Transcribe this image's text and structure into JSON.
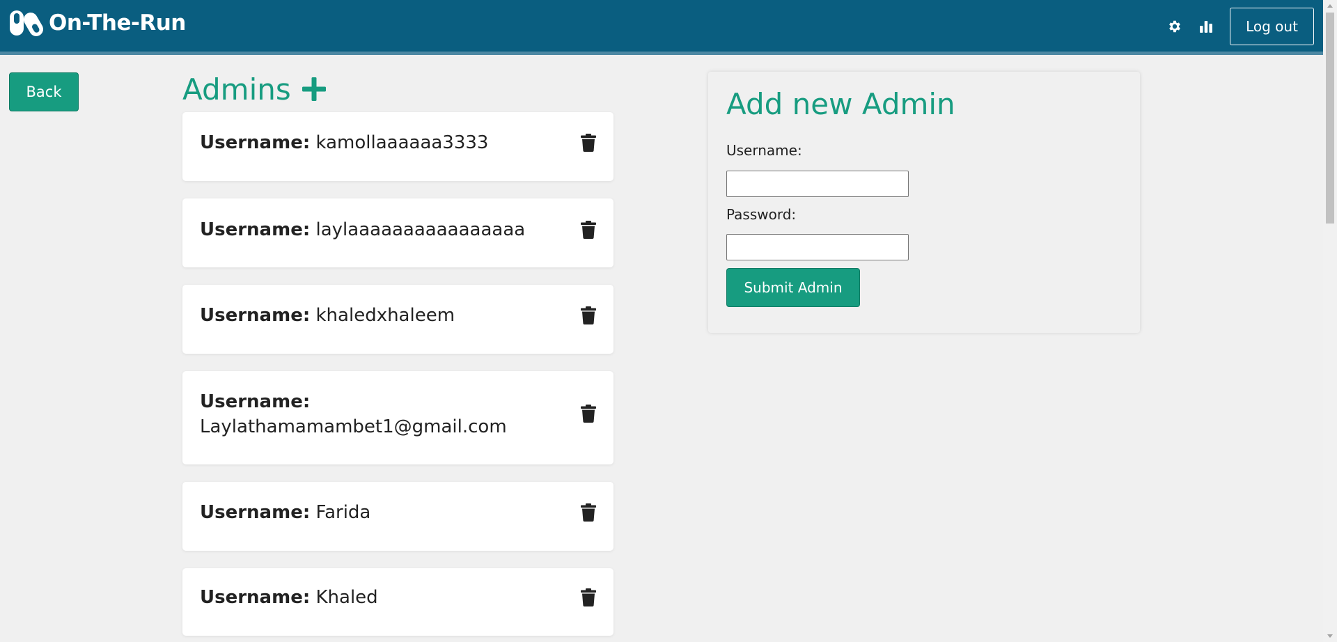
{
  "navbar": {
    "brand_name": "On-The-Run",
    "brand_icon": "pills-logo-icon",
    "settings_icon": "gear-icon",
    "stats_icon": "bar-chart-icon",
    "logout_label": "Log out",
    "bg_color": "#0a5e80"
  },
  "back_label": "Back",
  "admins": {
    "title": "Admins",
    "add_icon": "plus-icon",
    "field_label": "Username:",
    "items": [
      {
        "username": "kamollaaaaaa3333"
      },
      {
        "username": "laylaaaaaaaaaaaaaaaa"
      },
      {
        "username": "khaledxhaleem"
      },
      {
        "username": "Laylathamamambet1@gmail.com"
      },
      {
        "username": "Farida"
      },
      {
        "username": "Khaled"
      }
    ]
  },
  "form": {
    "title": "Add new Admin",
    "username_label": "Username:",
    "username_value": "",
    "password_label": "Password:",
    "password_value": "",
    "submit_label": "Submit Admin"
  },
  "colors": {
    "accent": "#179c80",
    "page_bg": "#f0f0f0"
  }
}
